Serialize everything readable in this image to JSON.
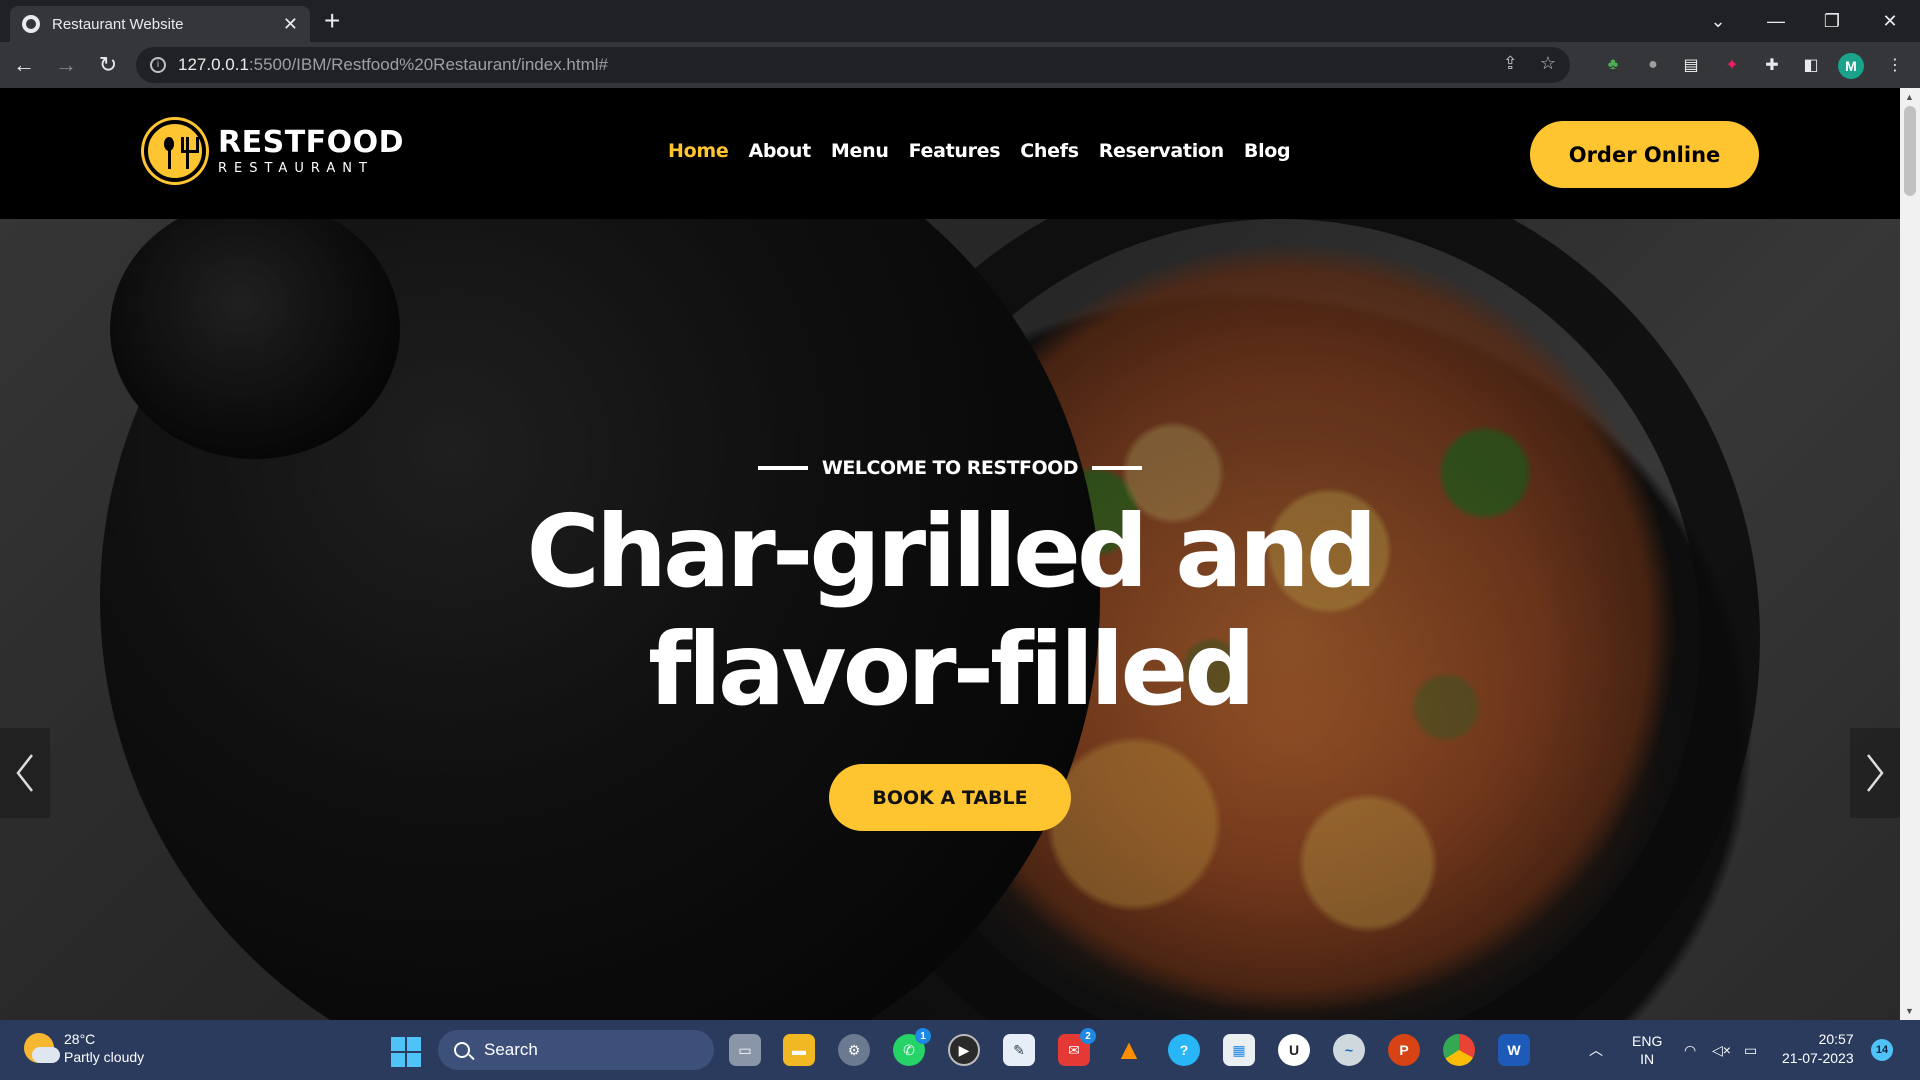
{
  "browser": {
    "tab_title": "Restaurant Website",
    "url_host": "127.0.0.1",
    "url_path": ":5500/IBM/Restfood%20Restaurant/index.html#",
    "profile_initial": "M"
  },
  "site": {
    "logo_main": "RESTFOOD",
    "logo_sub": "RESTAURANT",
    "nav": [
      "Home",
      "About",
      "Menu",
      "Features",
      "Chefs",
      "Reservation",
      "Blog"
    ],
    "active_nav": "Home",
    "order_button": "Order Online",
    "accent_color": "#ffc530"
  },
  "hero": {
    "eyebrow": "WELCOME TO RESTFOOD",
    "headline_line1": "Char-grilled and",
    "headline_line2": "flavor-filled",
    "cta": "BOOK A TABLE"
  },
  "taskbar": {
    "temperature": "28°C",
    "weather": "Partly cloudy",
    "search_placeholder": "Search",
    "whatsapp_badge": "1",
    "mail_badge": "2",
    "language_line1": "ENG",
    "language_line2": "IN",
    "time": "20:57",
    "date": "21-07-2023",
    "notification_count": "14"
  }
}
